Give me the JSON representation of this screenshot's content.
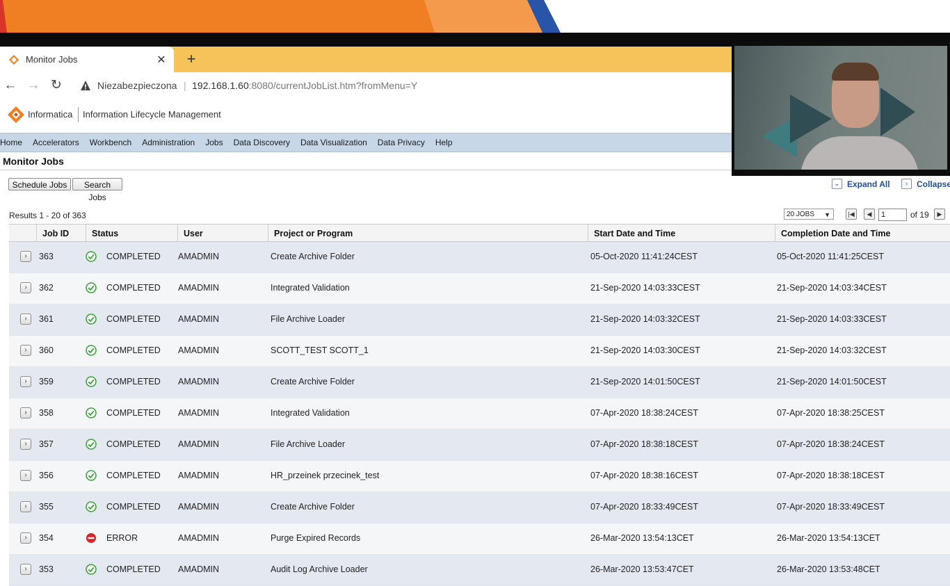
{
  "browser": {
    "tab_title": "Monitor Jobs",
    "new_tab": "+",
    "not_secure": "Niezabezpieczona",
    "url_host": "192.168.1.60",
    "url_rest": ":8080/currentJobList.htm?fromMenu=Y"
  },
  "app": {
    "brand": "Informatica",
    "product": "Information Lifecycle Management",
    "accent": "#f07e22"
  },
  "menu": [
    "Home",
    "Accelerators",
    "Workbench",
    "Administration",
    "Jobs",
    "Data Discovery",
    "Data Visualization",
    "Data Privacy",
    "Help"
  ],
  "page": {
    "title": "Monitor Jobs",
    "schedule_jobs": "Schedule Jobs",
    "search_jobs": "Search Jobs",
    "expand_all": "Expand All",
    "collapse": "Collapse",
    "results": "Results 1 - 20 of 363",
    "jobs_per_page": "20 JOBS",
    "current_page": "1",
    "of_pages": "of 19"
  },
  "table": {
    "headers": [
      "Job ID",
      "Status",
      "User",
      "Project or Program",
      "Start Date and Time",
      "Completion Date and Time"
    ],
    "rows": [
      {
        "id": "363",
        "status": "COMPLETED",
        "user": "AMADMIN",
        "program": "Create Archive Folder",
        "start": "05-Oct-2020 11:41:24CEST",
        "end": "05-Oct-2020 11:41:25CEST"
      },
      {
        "id": "362",
        "status": "COMPLETED",
        "user": "AMADMIN",
        "program": "Integrated Validation",
        "start": "21-Sep-2020 14:03:33CEST",
        "end": "21-Sep-2020 14:03:34CEST"
      },
      {
        "id": "361",
        "status": "COMPLETED",
        "user": "AMADMIN",
        "program": "File Archive Loader",
        "start": "21-Sep-2020 14:03:32CEST",
        "end": "21-Sep-2020 14:03:33CEST"
      },
      {
        "id": "360",
        "status": "COMPLETED",
        "user": "AMADMIN",
        "program": "SCOTT_TEST SCOTT_1",
        "start": "21-Sep-2020 14:03:30CEST",
        "end": "21-Sep-2020 14:03:32CEST"
      },
      {
        "id": "359",
        "status": "COMPLETED",
        "user": "AMADMIN",
        "program": "Create Archive Folder",
        "start": "21-Sep-2020 14:01:50CEST",
        "end": "21-Sep-2020 14:01:50CEST"
      },
      {
        "id": "358",
        "status": "COMPLETED",
        "user": "AMADMIN",
        "program": "Integrated Validation",
        "start": "07-Apr-2020 18:38:24CEST",
        "end": "07-Apr-2020 18:38:25CEST"
      },
      {
        "id": "357",
        "status": "COMPLETED",
        "user": "AMADMIN",
        "program": "File Archive Loader",
        "start": "07-Apr-2020 18:38:18CEST",
        "end": "07-Apr-2020 18:38:24CEST"
      },
      {
        "id": "356",
        "status": "COMPLETED",
        "user": "AMADMIN",
        "program": "HR_przeinek przecinek_test",
        "start": "07-Apr-2020 18:38:16CEST",
        "end": "07-Apr-2020 18:38:18CEST"
      },
      {
        "id": "355",
        "status": "COMPLETED",
        "user": "AMADMIN",
        "program": "Create Archive Folder",
        "start": "07-Apr-2020 18:33:49CEST",
        "end": "07-Apr-2020 18:33:49CEST"
      },
      {
        "id": "354",
        "status": "ERROR",
        "user": "AMADMIN",
        "program": "Purge Expired Records",
        "start": "26-Mar-2020 13:54:13CET",
        "end": "26-Mar-2020 13:54:13CET"
      },
      {
        "id": "353",
        "status": "COMPLETED",
        "user": "AMADMIN",
        "program": "Audit Log Archive Loader",
        "start": "26-Mar-2020 13:53:47CET",
        "end": "26-Mar-2020 13:53:48CET"
      }
    ]
  },
  "colors": {
    "completed": "#3aa83a",
    "error": "#d62626",
    "menubar": "#c7d7e8"
  }
}
